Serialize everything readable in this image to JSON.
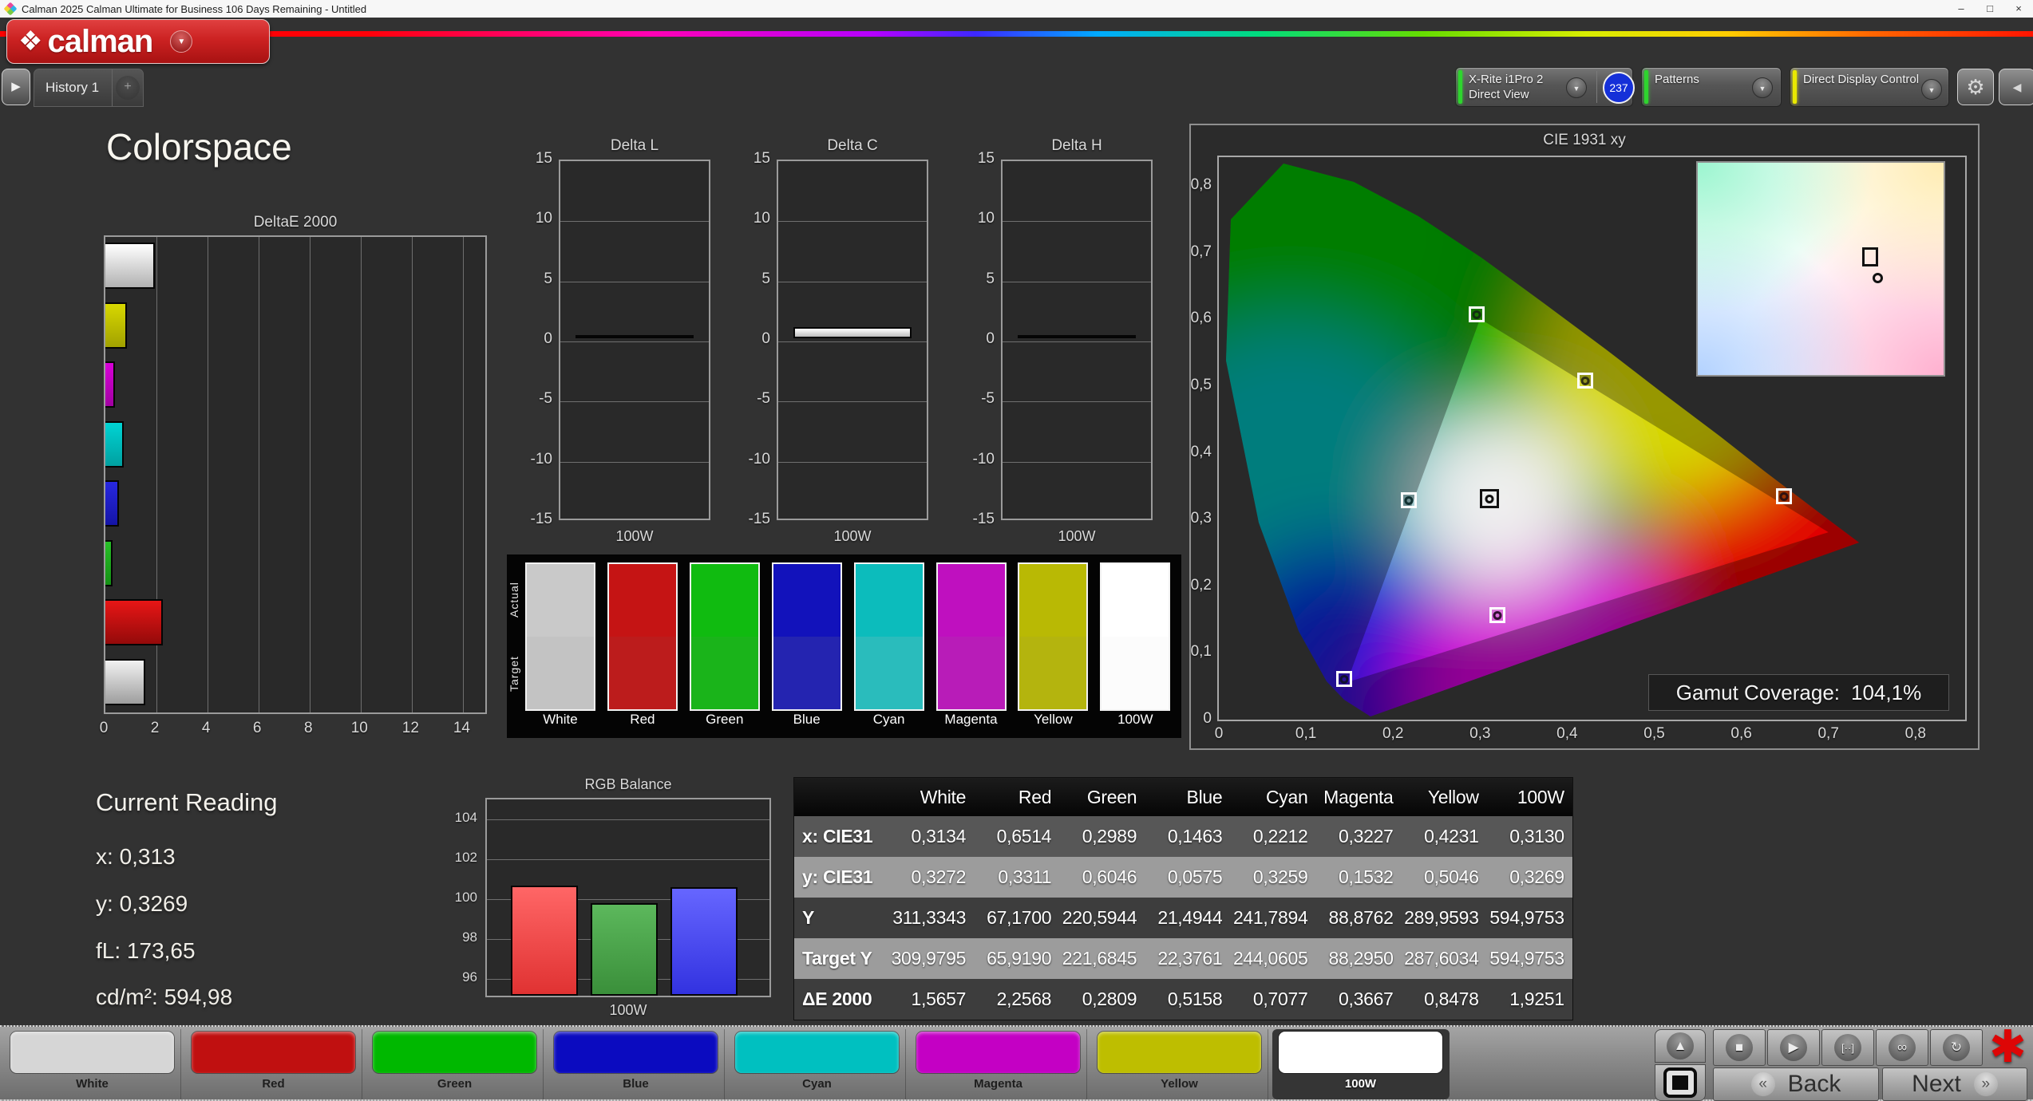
{
  "window": {
    "title": "Calman 2025 Calman Ultimate for Business 106 Days Remaining  - Untitled",
    "minimize": "–",
    "maximize": "□",
    "close": "×"
  },
  "header": {
    "logo_text": "calman",
    "logo_diamond": "❖",
    "logo_arrow": "▼",
    "tab_play": "▶",
    "history_tab": "History 1",
    "add_tab": "+",
    "meter": {
      "line1": "X-Rite i1Pro 2",
      "line2": "Direct View",
      "badge": "237",
      "arrow": "▼"
    },
    "patterns": "Patterns",
    "display_control": "Direct Display Control",
    "gear": "⚙",
    "edge_arrow": "◀"
  },
  "page_title": "Colorspace",
  "current_reading": {
    "title": "Current Reading",
    "lines": [
      {
        "label": "x:",
        "value": "0,313"
      },
      {
        "label": "y:",
        "value": "0,3269"
      },
      {
        "label": "fL:",
        "value": "173,65"
      },
      {
        "label": "cd/m²:",
        "value": "594,98"
      }
    ]
  },
  "gamut": {
    "label": "Gamut Coverage:",
    "value": "104,1%"
  },
  "comparison": {
    "actual": "Actual",
    "target": "Target",
    "columns": [
      {
        "name": "White",
        "actual": "#c9c9c9",
        "target": "#c3c3c3"
      },
      {
        "name": "Red",
        "actual": "#c51414",
        "target": "#bc1c1c"
      },
      {
        "name": "Green",
        "actual": "#10bb10",
        "target": "#1ab41a"
      },
      {
        "name": "Blue",
        "actual": "#1212bb",
        "target": "#2424b0"
      },
      {
        "name": "Cyan",
        "actual": "#0cbcbc",
        "target": "#2abcbc"
      },
      {
        "name": "Magenta",
        "actual": "#bf10bf",
        "target": "#b81cb8"
      },
      {
        "name": "Yellow",
        "actual": "#b9b904",
        "target": "#b4b40e"
      },
      {
        "name": "100W",
        "actual": "#ffffff",
        "target": "#fcfcfc"
      }
    ]
  },
  "bottom_bar": {
    "patterns": [
      {
        "name": "White",
        "hex": "#d6d6d6",
        "selected": false
      },
      {
        "name": "Red",
        "hex": "#c01010",
        "selected": false
      },
      {
        "name": "Green",
        "hex": "#00b800",
        "selected": false
      },
      {
        "name": "Blue",
        "hex": "#0b0bc0",
        "selected": false
      },
      {
        "name": "Cyan",
        "hex": "#00c0c0",
        "selected": false
      },
      {
        "name": "Magenta",
        "hex": "#c400c4",
        "selected": false
      },
      {
        "name": "Yellow",
        "hex": "#bebe00",
        "selected": false
      },
      {
        "name": "100W",
        "hex": "#ffffff",
        "selected": true
      }
    ]
  },
  "controls": {
    "up": "▲",
    "stop": "■",
    "play": "▶",
    "range": "[··]",
    "loop": "∞",
    "refresh": "↻",
    "asterisk": "✱"
  },
  "nav": {
    "back": "Back",
    "next": "Next",
    "back_icon": "«",
    "next_icon": "»"
  },
  "chart_data": [
    {
      "id": "deltae2000",
      "type": "bar",
      "orientation": "horizontal",
      "title": "DeltaE 2000",
      "xlim": [
        0,
        14.86
      ],
      "xticks": [
        "0",
        "2",
        "4",
        "6",
        "8",
        "10",
        "12",
        "14"
      ],
      "grid": true,
      "bars": [
        {
          "name": "100W",
          "value": 1.9251,
          "c1": "#ffffff",
          "c2": "#b2b2b2"
        },
        {
          "name": "Yellow",
          "value": 0.8478,
          "c1": "#d8d800",
          "c2": "#a2a200"
        },
        {
          "name": "Magenta",
          "value": 0.3667,
          "c1": "#d800d8",
          "c2": "#a200a2"
        },
        {
          "name": "Cyan",
          "value": 0.7077,
          "c1": "#00d4d4",
          "c2": "#00a0a0"
        },
        {
          "name": "Blue",
          "value": 0.5158,
          "c1": "#2828e0",
          "c2": "#1414a6"
        },
        {
          "name": "Green",
          "value": 0.2809,
          "c1": "#28c028",
          "c2": "#149014"
        },
        {
          "name": "Red",
          "value": 2.2568,
          "c1": "#e81616",
          "c2": "#940a0a"
        },
        {
          "name": "White",
          "value": 1.5657,
          "c1": "#f2f2f2",
          "c2": "#9e9e9e"
        }
      ]
    },
    {
      "id": "delta_l",
      "type": "bar",
      "title": "Delta L",
      "categories": [
        "100W"
      ],
      "values": [
        0.25
      ],
      "ylim": [
        -15,
        15
      ],
      "yticks": [
        "15",
        "10",
        "5",
        "0",
        "-5",
        "-10",
        "-15"
      ],
      "xlabel": "100W",
      "bar_c1": "#2e2e2e",
      "bar_c2": "#101010"
    },
    {
      "id": "delta_c",
      "type": "bar",
      "title": "Delta C",
      "categories": [
        "100W"
      ],
      "values": [
        0.9
      ],
      "ylim": [
        -15,
        15
      ],
      "yticks": [
        "15",
        "10",
        "5",
        "0",
        "-5",
        "-10",
        "-15"
      ],
      "xlabel": "100W",
      "bar_c1": "#ffffff",
      "bar_c2": "#bdbdbd"
    },
    {
      "id": "delta_h",
      "type": "bar",
      "title": "Delta H",
      "categories": [
        "100W"
      ],
      "values": [
        0.12
      ],
      "ylim": [
        -15,
        15
      ],
      "yticks": [
        "15",
        "10",
        "5",
        "0",
        "-5",
        "-10",
        "-15"
      ],
      "xlabel": "100W",
      "bar_c1": "#2e2e2e",
      "bar_c2": "#101010"
    },
    {
      "id": "rgb_balance",
      "type": "bar",
      "title": "RGB Balance",
      "categories": [
        "Red",
        "Green",
        "Blue"
      ],
      "values": [
        100.7,
        99.8,
        100.6
      ],
      "ylim": [
        95,
        105
      ],
      "yticks": [
        "104",
        "102",
        "100",
        "98",
        "96"
      ],
      "xlabel": "100W",
      "colors": [
        {
          "c1": "#ff6666",
          "c2": "#e03232"
        },
        {
          "c1": "#5cb85c",
          "c2": "#3a8f3a"
        },
        {
          "c1": "#6666ff",
          "c2": "#3232e0"
        }
      ]
    },
    {
      "id": "cie1931",
      "type": "scatter",
      "title": "CIE 1931 xy",
      "xticks": [
        "0",
        "0,1",
        "0,2",
        "0,3",
        "0,4",
        "0,5",
        "0,6",
        "0,7",
        "0,8"
      ],
      "yticks": [
        "0,8",
        "0,7",
        "0,6",
        "0,5",
        "0,4",
        "0,3",
        "0,2",
        "0,1",
        "0"
      ],
      "xlim": [
        0,
        0.857
      ],
      "ylim": [
        0,
        0.843
      ],
      "points": [
        {
          "name": "White",
          "x": 0.3134,
          "y": 0.3272,
          "ring": "#111111",
          "dot": "#111111"
        },
        {
          "name": "Red",
          "x": 0.6514,
          "y": 0.3311,
          "ring": "#ffffff",
          "dot": "#301010"
        },
        {
          "name": "Green",
          "x": 0.2989,
          "y": 0.6046,
          "ring": "#ffffff",
          "dot": "#103010"
        },
        {
          "name": "Blue",
          "x": 0.1463,
          "y": 0.0575,
          "ring": "#ffffff",
          "dot": "#101030"
        },
        {
          "name": "Cyan",
          "x": 0.2212,
          "y": 0.3259,
          "ring": "#ffffff",
          "dot": "#103030"
        },
        {
          "name": "Magenta",
          "x": 0.3227,
          "y": 0.1532,
          "ring": "#ffffff",
          "dot": "#301030"
        },
        {
          "name": "Yellow",
          "x": 0.4231,
          "y": 0.5046,
          "ring": "#ffffff",
          "dot": "#303010"
        }
      ],
      "triangle": [
        [
          0.3,
          0.601
        ],
        [
          0.147,
          0.056
        ],
        [
          0.7,
          0.281
        ]
      ],
      "legend_position": "none"
    },
    {
      "id": "measurements",
      "type": "table",
      "columns": [
        "White",
        "Red",
        "Green",
        "Blue",
        "Cyan",
        "Magenta",
        "Yellow",
        "100W"
      ],
      "rows": [
        {
          "label": "x: CIE31",
          "values": [
            "0,3134",
            "0,6514",
            "0,2989",
            "0,1463",
            "0,2212",
            "0,3227",
            "0,4231",
            "0,3130"
          ]
        },
        {
          "label": "y: CIE31",
          "values": [
            "0,3272",
            "0,3311",
            "0,6046",
            "0,0575",
            "0,3259",
            "0,1532",
            "0,5046",
            "0,3269"
          ]
        },
        {
          "label": "Y",
          "values": [
            "311,3343",
            "67,1700",
            "220,5944",
            "21,4944",
            "241,7894",
            "88,8762",
            "289,9593",
            "594,9753"
          ]
        },
        {
          "label": "Target Y",
          "values": [
            "309,9795",
            "65,9190",
            "221,6845",
            "22,3761",
            "244,0605",
            "88,2950",
            "287,6034",
            "594,9753"
          ]
        },
        {
          "label": "ΔE 2000",
          "values": [
            "1,5657",
            "2,2568",
            "0,2809",
            "0,5158",
            "0,7077",
            "0,3667",
            "0,8478",
            "1,9251"
          ]
        }
      ]
    }
  ]
}
